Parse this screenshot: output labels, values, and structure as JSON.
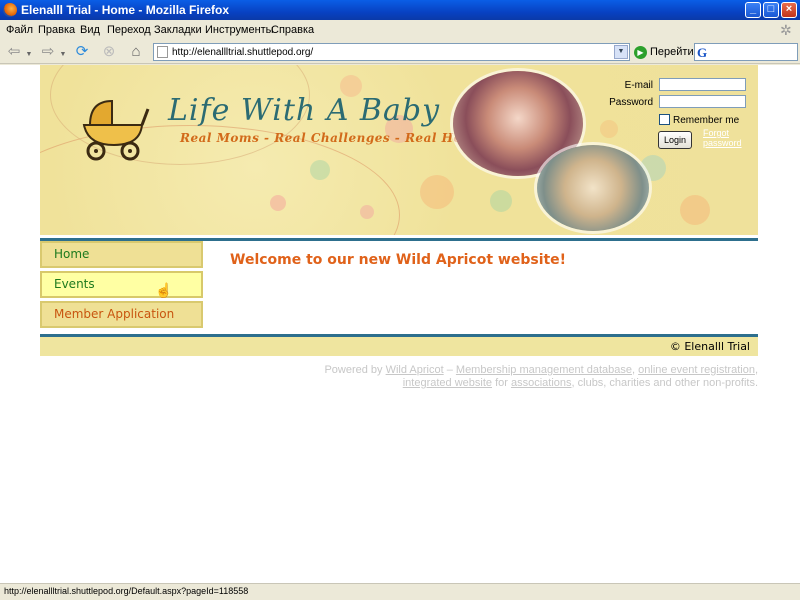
{
  "window": {
    "title": "Elenalll Trial - Home - Mozilla Firefox",
    "minimize": "_",
    "maximize": "□",
    "close": "×"
  },
  "menubar": {
    "items": [
      "Файл",
      "Правка",
      "Вид",
      "Переход",
      "Закладки",
      "Инструменты",
      "Справка"
    ]
  },
  "toolbar": {
    "url": "http://elenallltrial.shuttlepod.org/",
    "go_label": "Перейти",
    "search_value": ""
  },
  "site": {
    "title": "Life With A Baby",
    "tagline": "Real Moms - Real Challenges - Real Help",
    "login": {
      "email_label": "E-mail",
      "password_label": "Password",
      "email_value": "",
      "password_value": "",
      "remember_label": "Remember me",
      "login_button": "Login",
      "forgot_password": "Forgot password"
    },
    "nav": {
      "home": "Home",
      "events": "Events",
      "member_application": "Member Application"
    },
    "welcome": "Welcome to our new Wild Apricot website!",
    "footer_copyright": "© Elenalll Trial",
    "powered": {
      "prefix": "Powered by ",
      "wild_apricot": "Wild Apricot",
      "dash": " – ",
      "membership_db": "Membership management database",
      "comma1": ", ",
      "online_event": "online event registration",
      "comma2": ",",
      "integrated_website": "integrated website",
      "for": " for ",
      "associations": "associations",
      "suffix": ", clubs, charities and other non-profits."
    }
  },
  "statusbar": {
    "text": "http://elenallltrial.shuttlepod.org/Default.aspx?pageId=118558"
  },
  "colors": {
    "title_teal": "#2b6b73",
    "tagline_orange": "#d26a1a",
    "welcome_orange": "#e0621a",
    "nav_green": "#1e7a1e",
    "rule_blue": "#2d6f8d"
  }
}
